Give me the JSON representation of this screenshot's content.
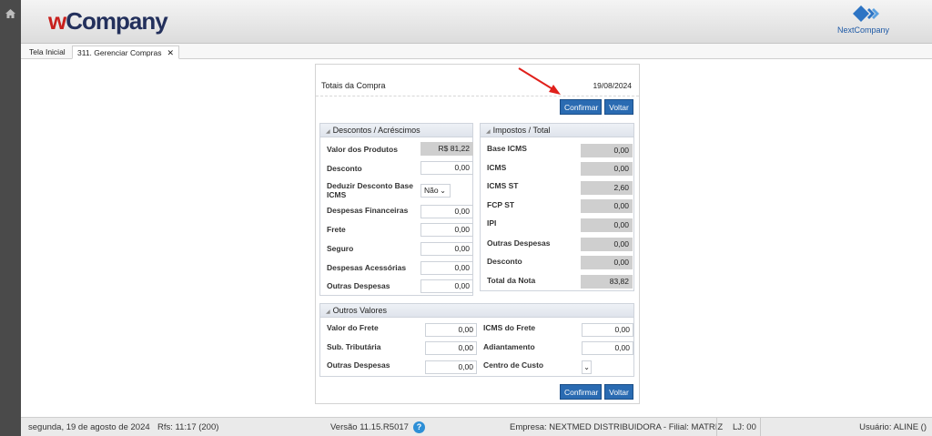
{
  "header": {
    "logo_w": "w",
    "logo_rest": "Company",
    "partner_logo": "NextCompany"
  },
  "tabs": [
    {
      "label": "Tela Inicial"
    },
    {
      "label": "311. Gerenciar Compras",
      "close": "✕"
    }
  ],
  "panel": {
    "title": "Totais da Compra",
    "date": "19/08/2024",
    "confirm_label": "Confirmar",
    "back_label": "Voltar"
  },
  "descontos": {
    "title": "Descontos / Acréscimos",
    "rows": [
      {
        "label": "Valor dos Produtos",
        "value": "R$ 81,22"
      },
      {
        "label": "Desconto",
        "value": "0,00"
      },
      {
        "label": "Deduzir Desconto Base ICMS",
        "value": "Não"
      },
      {
        "label": "Despesas Financeiras",
        "value": "0,00"
      },
      {
        "label": "Frete",
        "value": "0,00"
      },
      {
        "label": "Seguro",
        "value": "0,00"
      },
      {
        "label": "Despesas Acessórias",
        "value": "0,00"
      },
      {
        "label": "Outras Despesas",
        "value": "0,00"
      }
    ]
  },
  "impostos": {
    "title": "Impostos / Total",
    "rows": [
      {
        "label": "Base ICMS",
        "value": "0,00"
      },
      {
        "label": "ICMS",
        "value": "0,00"
      },
      {
        "label": "ICMS ST",
        "value": "2,60"
      },
      {
        "label": "FCP ST",
        "value": "0,00"
      },
      {
        "label": "IPI",
        "value": "0,00"
      },
      {
        "label": "Outras Despesas",
        "value": "0,00"
      },
      {
        "label": "Desconto",
        "value": "0,00"
      },
      {
        "label": "Total da Nota",
        "value": "83,82"
      }
    ]
  },
  "outros": {
    "title": "Outros Valores",
    "left": [
      {
        "label": "Valor do Frete",
        "value": "0,00"
      },
      {
        "label": "Sub. Tributária",
        "value": "0,00"
      },
      {
        "label": "Outras Despesas",
        "value": "0,00"
      }
    ],
    "right": [
      {
        "label": "ICMS do Frete",
        "value": "0,00"
      },
      {
        "label": "Adiantamento",
        "value": "0,00"
      },
      {
        "label": "Centro de Custo",
        "value": ""
      }
    ]
  },
  "status": {
    "date_text": "segunda, 19 de agosto de 2024",
    "rfs_text": "Rfs: 11:17 (200)",
    "version": "Versão 11.15.R5017",
    "help": "?",
    "company": "Empresa: NEXTMED DISTRIBUIDORA - Filial: MATRIZ",
    "lj": "LJ: 00",
    "user": "Usuário: ALINE ()"
  },
  "colors": {
    "primary_button": "#2a6bb2",
    "annotation_arrow": "#e0201b",
    "logo_red": "#c8201d",
    "logo_navy": "#23305c"
  }
}
